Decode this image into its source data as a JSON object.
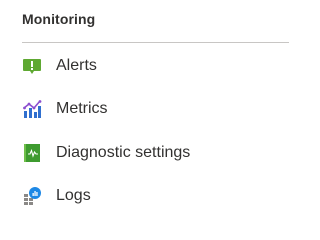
{
  "section": {
    "title": "Monitoring"
  },
  "nav_items": [
    {
      "label": "Alerts",
      "icon": "alerts-icon"
    },
    {
      "label": "Metrics",
      "icon": "metrics-icon"
    },
    {
      "label": "Diagnostic settings",
      "icon": "diagnostic-settings-icon"
    },
    {
      "label": "Logs",
      "icon": "logs-icon"
    }
  ],
  "colors": {
    "text": "#323130",
    "divider": "#c8c6c4",
    "alerts_green": "#5ea832",
    "metrics_blue": "#2f6fcf",
    "metrics_purple": "#8c4fd0",
    "diag_green": "#3e9b2f",
    "logs_blue": "#1e88e5"
  }
}
